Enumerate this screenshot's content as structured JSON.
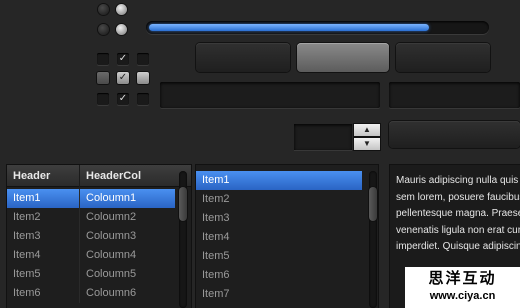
{
  "radios": [
    {
      "state": "off"
    },
    {
      "state": "on"
    },
    {
      "state": "off"
    },
    {
      "state": "on"
    }
  ],
  "progress": {
    "value_fraction": 0.83
  },
  "checkbox_rows": [
    [
      {
        "checked": false,
        "style": "dark"
      },
      {
        "checked": true,
        "style": "dark"
      },
      {
        "checked": false,
        "style": "dark"
      }
    ],
    [
      {
        "checked": false,
        "style": "mid"
      },
      {
        "checked": true,
        "style": "light"
      },
      {
        "checked": false,
        "style": "light"
      }
    ],
    [
      {
        "checked": false,
        "style": "dark"
      },
      {
        "checked": true,
        "style": "dark"
      },
      {
        "checked": false,
        "style": "dark"
      }
    ]
  ],
  "checkmark_glyph": "✓",
  "spinner": {
    "value": "",
    "up_icon": "▲",
    "down_icon": "▼"
  },
  "table": {
    "headers": [
      "Header",
      "HeaderCol"
    ],
    "rows": [
      [
        "Item1",
        "Coloumn1"
      ],
      [
        "Item2",
        "Coloumn2"
      ],
      [
        "Item3",
        "Coloumn3"
      ],
      [
        "Item4",
        "Coloumn4"
      ],
      [
        "Item5",
        "Coloumn5"
      ],
      [
        "Item6",
        "Coloumn6"
      ]
    ],
    "selected_index": 0
  },
  "list": {
    "items": [
      "Item1",
      "Item2",
      "Item3",
      "Item4",
      "Item5",
      "Item6",
      "Item7"
    ],
    "selected_index": 0
  },
  "textarea": {
    "text": "Mauris adipiscing nulla quis Duis sem lorem, posuere faucibus id, pellentesque magna. Praesent venenatis ligula non erat cursus imperdiet. Quisque adipiscing dui"
  },
  "watermark": {
    "line1": "思洋互动",
    "line2": "www.ciya.cn"
  },
  "colors": {
    "accent": "#2f7be0",
    "background": "#262626"
  }
}
